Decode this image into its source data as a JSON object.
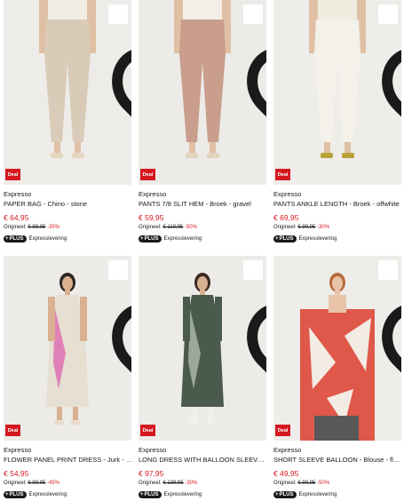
{
  "products": [
    {
      "brand": "Expresso",
      "title": "PAPER BAG - Chino - stone",
      "price": "€ 64,95",
      "orig_label": "Origineel:",
      "orig_price": "€ 99,95",
      "discount": "-35%",
      "deal": "Deal",
      "plus": "PLUS",
      "express": "Expresslevering",
      "wishlist_icon": "heart-outline-icon",
      "colors": {
        "bg": "#eeece8",
        "garment": "#d9cbb8",
        "skin": "#e0c0a4",
        "top": "#f2ede4",
        "shoe": "#e6d8c0"
      }
    },
    {
      "brand": "Expresso",
      "title": "PANTS 7/8 SLIT HEM - Broek - gravel",
      "price": "€ 59,95",
      "orig_label": "Origineel:",
      "orig_price": "€ 119,95",
      "discount": "-50%",
      "deal": "Deal",
      "plus": "PLUS",
      "express": "Expresslevering",
      "wishlist_icon": "heart-outline-icon",
      "colors": {
        "bg": "#ecebe8",
        "garment": "#c99e8c",
        "skin": "#e0c0a4",
        "top": "#f3efe6",
        "shoe": "#e3d5bd"
      }
    },
    {
      "brand": "Expresso",
      "title": "PANTS ANKLE LENGTH - Broek - offwhite",
      "price": "€ 69,95",
      "orig_label": "Origineel:",
      "orig_price": "€ 99,95",
      "discount": "-30%",
      "deal": "Deal",
      "plus": "PLUS",
      "express": "Expresslevering",
      "wishlist_icon": "heart-outline-icon",
      "colors": {
        "bg": "#eeedea",
        "garment": "#f4f1ea",
        "skin": "#e0c0a4",
        "top": "#f0ebdf",
        "shoe": "#b9a23a"
      }
    },
    {
      "brand": "Expresso",
      "title": "FLOWER PANEL PRINT DRESS - Jurk - stone",
      "price": "€ 54,95",
      "orig_label": "Origineel:",
      "orig_price": "€ 99,95",
      "discount": "-45%",
      "deal": "Deal",
      "plus": "PLUS",
      "express": "Expresslevering",
      "wishlist_icon": "heart-outline-icon",
      "colors": {
        "bg": "#ecebe8",
        "garment": "#e6dfd2",
        "accent": "#e080b8",
        "skin": "#d9b090",
        "hair": "#2a2420",
        "shoe": "#e8dcc8"
      }
    },
    {
      "brand": "Expresso",
      "title": "LONG DRESS WITH BALLOON SLEEVES - Jurk",
      "price": "€ 97,95",
      "orig_label": "Origineel:",
      "orig_price": "€ 139,95",
      "discount": "-30%",
      "deal": "Deal",
      "plus": "PLUS",
      "express": "Expresslevering",
      "wishlist_icon": "heart-outline-icon",
      "colors": {
        "bg": "#ecebe8",
        "garment": "#4a5a4c",
        "accent": "#9aa89a",
        "skin": "#d9b090",
        "hair": "#3a2a20",
        "shoe": "#f2f0ea"
      }
    },
    {
      "brand": "Expresso",
      "title": "SHORT SLEEVE BALLOON - Blouse - flamingo",
      "price": "€ 49,95",
      "orig_label": "Origineel:",
      "orig_price": "€ 99,95",
      "discount": "-50%",
      "deal": "Deal",
      "plus": "PLUS",
      "express": "Expresslevering",
      "wishlist_icon": "heart-outline-icon",
      "colors": {
        "bg": "#eeedea",
        "garment": "#e0584a",
        "accent": "#f2ece4",
        "skin": "#e8c4a8",
        "hair": "#b86a3a",
        "shoe": "#585858"
      }
    }
  ]
}
